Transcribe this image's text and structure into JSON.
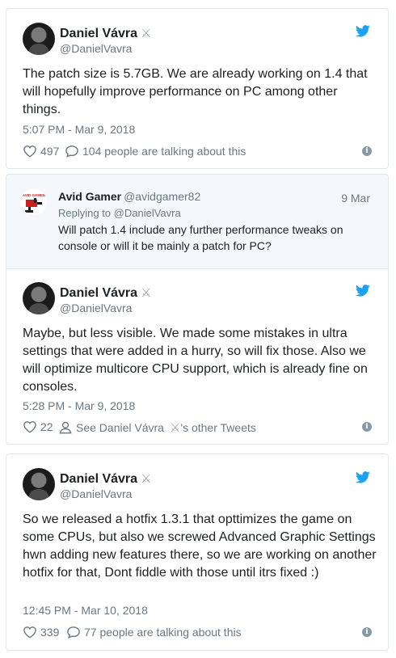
{
  "tweet1": {
    "name": "Daniel Vávra",
    "handle": "@DanielVavra",
    "text": "The patch size is 5.7GB. We are already working on 1.4 that will hopefully improve performance on PC among other things.",
    "time": "5:07 PM - Mar 9, 2018",
    "likes": "497",
    "talking": "104 people are talking about this"
  },
  "quote": {
    "name": "Avid Gamer",
    "handle": "@avidgamer82",
    "date": "9 Mar",
    "replying": "Replying to @DanielVavra",
    "text": "Will patch 1.4 include any further performance tweaks on console or will it be mainly a patch for PC?",
    "logo_text": "AVID GAMER"
  },
  "tweet2": {
    "name": "Daniel Vávra",
    "handle": "@DanielVavra",
    "text": "Maybe, but less visible. We made some mistakes in ultra settings that were added in a hurry, so will fix those. Also we will optimize multicore CPU support, which is already fine on consoles.",
    "time": "5:28 PM - Mar 9, 2018",
    "likes": "22",
    "see_prefix": "See Daniel Vávra",
    "see_suffix": "'s other Tweets"
  },
  "tweet3": {
    "name": "Daniel Vávra",
    "handle": "@DanielVavra",
    "text": "So we released a hotfix 1.3.1 that opttimizes the game on some CPUs, but also we screwed Advanced Graphic Settings hwn adding new features there, so we are working on another hotfix for that, Dont fiddle with those until itrs fixed :)",
    "time": "12:45 PM - Mar 10, 2018",
    "likes": "339",
    "talking": "77 people are talking about this"
  },
  "icons": {
    "swords": "crossed-swords-icon",
    "bird": "twitter-bird-icon",
    "heart": "heart-icon",
    "comment": "comment-icon",
    "person": "person-icon",
    "info": "info-icon"
  },
  "colors": {
    "brand_blue": "#1da1f2",
    "text": "#1c2022",
    "muted": "#697882",
    "border": "#e1e8ed",
    "quote_bg": "#f5f8fa"
  }
}
